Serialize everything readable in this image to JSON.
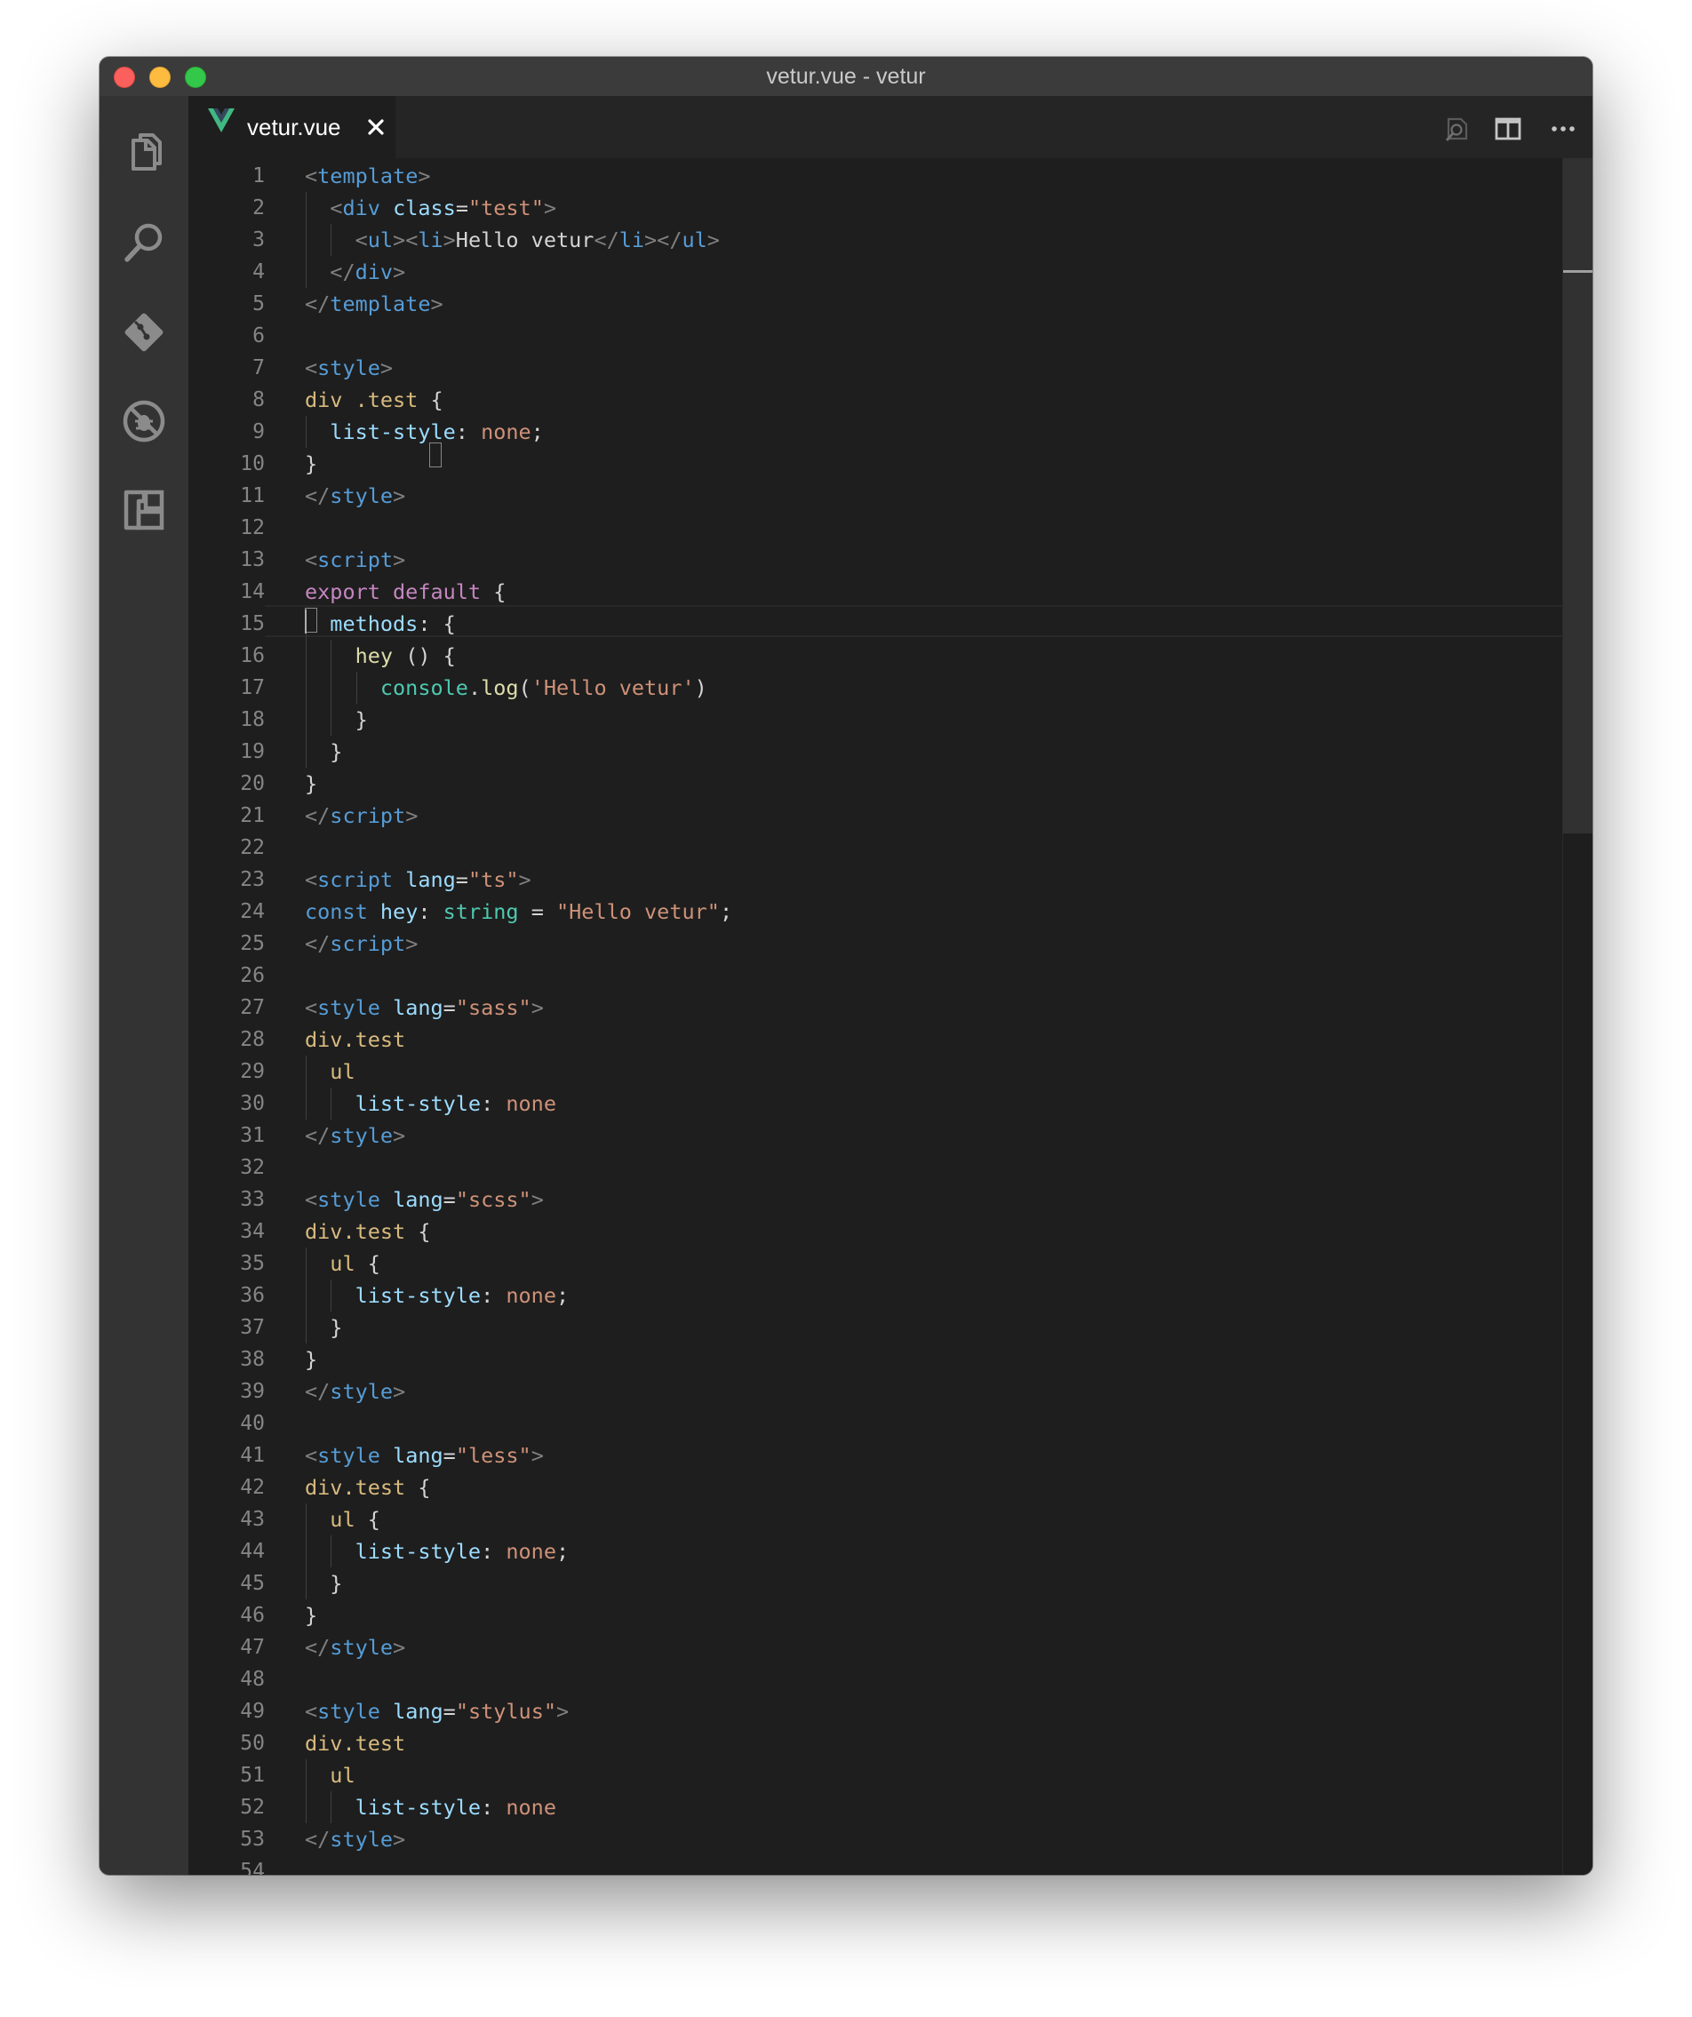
{
  "window": {
    "title": "vetur.vue - vetur"
  },
  "tab": {
    "label": "vetur.vue",
    "icon": "vue-icon"
  },
  "activity_icons": [
    "explorer-icon",
    "search-icon",
    "source-control-icon",
    "debug-icon",
    "extensions-icon"
  ],
  "toolbar_icons": [
    "open-preview-icon",
    "split-editor-icon",
    "more-actions-icon"
  ],
  "line_numbers": [
    "1",
    "2",
    "3",
    "4",
    "5",
    "6",
    "7",
    "8",
    "9",
    "10",
    "11",
    "12",
    "13",
    "14",
    "15",
    "16",
    "17",
    "18",
    "19",
    "20",
    "21",
    "22",
    "23",
    "24",
    "25",
    "26",
    "27",
    "28",
    "29",
    "30",
    "31",
    "32",
    "33",
    "34",
    "35",
    "36",
    "37",
    "38",
    "39",
    "40",
    "41",
    "42",
    "43",
    "44",
    "45",
    "46",
    "47",
    "48",
    "49",
    "50",
    "51",
    "52",
    "53",
    "54"
  ],
  "code_lines": [
    [
      [
        "p",
        "<"
      ],
      [
        "t",
        "template"
      ],
      [
        "p",
        ">"
      ]
    ],
    [
      [
        "s",
        "  "
      ],
      [
        "p",
        "<"
      ],
      [
        "t",
        "div"
      ],
      [
        "s",
        " "
      ],
      [
        "a",
        "class"
      ],
      [
        "x",
        "="
      ],
      [
        "q",
        "\"test\""
      ],
      [
        "p",
        ">"
      ]
    ],
    [
      [
        "s",
        "    "
      ],
      [
        "p",
        "<"
      ],
      [
        "t",
        "ul"
      ],
      [
        "p",
        "><"
      ],
      [
        "t",
        "li"
      ],
      [
        "p",
        ">"
      ],
      [
        "x",
        "Hello vetur"
      ],
      [
        "p",
        "</"
      ],
      [
        "t",
        "li"
      ],
      [
        "p",
        "></"
      ],
      [
        "t",
        "ul"
      ],
      [
        "p",
        ">"
      ]
    ],
    [
      [
        "s",
        "  "
      ],
      [
        "p",
        "</"
      ],
      [
        "t",
        "div"
      ],
      [
        "p",
        ">"
      ]
    ],
    [
      [
        "p",
        "</"
      ],
      [
        "t",
        "template"
      ],
      [
        "p",
        ">"
      ]
    ],
    [],
    [
      [
        "p",
        "<"
      ],
      [
        "t",
        "style"
      ],
      [
        "p",
        ">"
      ]
    ],
    [
      [
        "e",
        "div .test"
      ],
      [
        "x",
        " {"
      ]
    ],
    [
      [
        "s",
        "  "
      ],
      [
        "a",
        "list-style"
      ],
      [
        "x",
        ": "
      ],
      [
        "q",
        "none"
      ],
      [
        "x",
        ";"
      ]
    ],
    [
      [
        "x",
        "}"
      ]
    ],
    [
      [
        "p",
        "</"
      ],
      [
        "t",
        "style"
      ],
      [
        "p",
        ">"
      ]
    ],
    [],
    [
      [
        "p",
        "<"
      ],
      [
        "t",
        "script"
      ],
      [
        "p",
        ">"
      ]
    ],
    [
      [
        "k",
        "export default"
      ],
      [
        "x",
        " {"
      ]
    ],
    [
      [
        "s",
        "  "
      ],
      [
        "a",
        "methods"
      ],
      [
        "x",
        ": {"
      ]
    ],
    [
      [
        "s",
        "    "
      ],
      [
        "f",
        "hey"
      ],
      [
        "x",
        " () {"
      ]
    ],
    [
      [
        "s",
        "      "
      ],
      [
        "v",
        "console"
      ],
      [
        "x",
        "."
      ],
      [
        "f",
        "log"
      ],
      [
        "x",
        "("
      ],
      [
        "q",
        "'Hello vetur'"
      ],
      [
        "x",
        ")"
      ]
    ],
    [
      [
        "s",
        "    "
      ],
      [
        "x",
        "}"
      ]
    ],
    [
      [
        "s",
        "  "
      ],
      [
        "x",
        "}"
      ]
    ],
    [
      [
        "x",
        "}"
      ]
    ],
    [
      [
        "p",
        "</"
      ],
      [
        "t",
        "script"
      ],
      [
        "p",
        ">"
      ]
    ],
    [],
    [
      [
        "p",
        "<"
      ],
      [
        "t",
        "script"
      ],
      [
        "s",
        " "
      ],
      [
        "a",
        "lang"
      ],
      [
        "x",
        "="
      ],
      [
        "q",
        "\"ts\""
      ],
      [
        "p",
        ">"
      ]
    ],
    [
      [
        "t",
        "const"
      ],
      [
        "s",
        " "
      ],
      [
        "a",
        "hey"
      ],
      [
        "x",
        ": "
      ],
      [
        "v",
        "string"
      ],
      [
        "x",
        " = "
      ],
      [
        "q",
        "\"Hello vetur\""
      ],
      [
        "x",
        ";"
      ]
    ],
    [
      [
        "p",
        "</"
      ],
      [
        "t",
        "script"
      ],
      [
        "p",
        ">"
      ]
    ],
    [],
    [
      [
        "p",
        "<"
      ],
      [
        "t",
        "style"
      ],
      [
        "s",
        " "
      ],
      [
        "a",
        "lang"
      ],
      [
        "x",
        "="
      ],
      [
        "q",
        "\"sass\""
      ],
      [
        "p",
        ">"
      ]
    ],
    [
      [
        "e",
        "div.test"
      ]
    ],
    [
      [
        "s",
        "  "
      ],
      [
        "e",
        "ul"
      ]
    ],
    [
      [
        "s",
        "    "
      ],
      [
        "a",
        "list-style"
      ],
      [
        "x",
        ": "
      ],
      [
        "q",
        "none"
      ]
    ],
    [
      [
        "p",
        "</"
      ],
      [
        "t",
        "style"
      ],
      [
        "p",
        ">"
      ]
    ],
    [],
    [
      [
        "p",
        "<"
      ],
      [
        "t",
        "style"
      ],
      [
        "s",
        " "
      ],
      [
        "a",
        "lang"
      ],
      [
        "x",
        "="
      ],
      [
        "q",
        "\"scss\""
      ],
      [
        "p",
        ">"
      ]
    ],
    [
      [
        "e",
        "div.test"
      ],
      [
        "x",
        " {"
      ]
    ],
    [
      [
        "s",
        "  "
      ],
      [
        "e",
        "ul"
      ],
      [
        "x",
        " {"
      ]
    ],
    [
      [
        "s",
        "    "
      ],
      [
        "a",
        "list-style"
      ],
      [
        "x",
        ": "
      ],
      [
        "q",
        "none"
      ],
      [
        "x",
        ";"
      ]
    ],
    [
      [
        "s",
        "  "
      ],
      [
        "x",
        "}"
      ]
    ],
    [
      [
        "x",
        "}"
      ]
    ],
    [
      [
        "p",
        "</"
      ],
      [
        "t",
        "style"
      ],
      [
        "p",
        ">"
      ]
    ],
    [],
    [
      [
        "p",
        "<"
      ],
      [
        "t",
        "style"
      ],
      [
        "s",
        " "
      ],
      [
        "a",
        "lang"
      ],
      [
        "x",
        "="
      ],
      [
        "q",
        "\"less\""
      ],
      [
        "p",
        ">"
      ]
    ],
    [
      [
        "e",
        "div.test"
      ],
      [
        "x",
        " {"
      ]
    ],
    [
      [
        "s",
        "  "
      ],
      [
        "e",
        "ul"
      ],
      [
        "x",
        " {"
      ]
    ],
    [
      [
        "s",
        "    "
      ],
      [
        "a",
        "list-style"
      ],
      [
        "x",
        ": "
      ],
      [
        "q",
        "none"
      ],
      [
        "x",
        ";"
      ]
    ],
    [
      [
        "s",
        "  "
      ],
      [
        "x",
        "}"
      ]
    ],
    [
      [
        "x",
        "}"
      ]
    ],
    [
      [
        "p",
        "</"
      ],
      [
        "t",
        "style"
      ],
      [
        "p",
        ">"
      ]
    ],
    [],
    [
      [
        "p",
        "<"
      ],
      [
        "t",
        "style"
      ],
      [
        "s",
        " "
      ],
      [
        "a",
        "lang"
      ],
      [
        "x",
        "="
      ],
      [
        "q",
        "\"stylus\""
      ],
      [
        "p",
        ">"
      ]
    ],
    [
      [
        "e",
        "div.test"
      ]
    ],
    [
      [
        "s",
        "  "
      ],
      [
        "e",
        "ul"
      ]
    ],
    [
      [
        "s",
        "    "
      ],
      [
        "a",
        "list-style"
      ],
      [
        "x",
        ": "
      ],
      [
        "q",
        "none"
      ]
    ],
    [
      [
        "p",
        "</"
      ],
      [
        "t",
        "style"
      ],
      [
        "p",
        ">"
      ]
    ],
    []
  ],
  "colors": {
    "punctuation": "#808080",
    "tag": "#569cd6",
    "attribute": "#9cdcfe",
    "string": "#ce9178",
    "keyword": "#c586c0",
    "selector": "#d7ba7d",
    "function": "#dcdcaa",
    "type": "#4ec9b0",
    "text": "#d4d4d4",
    "vue_brand": "#41b883"
  }
}
